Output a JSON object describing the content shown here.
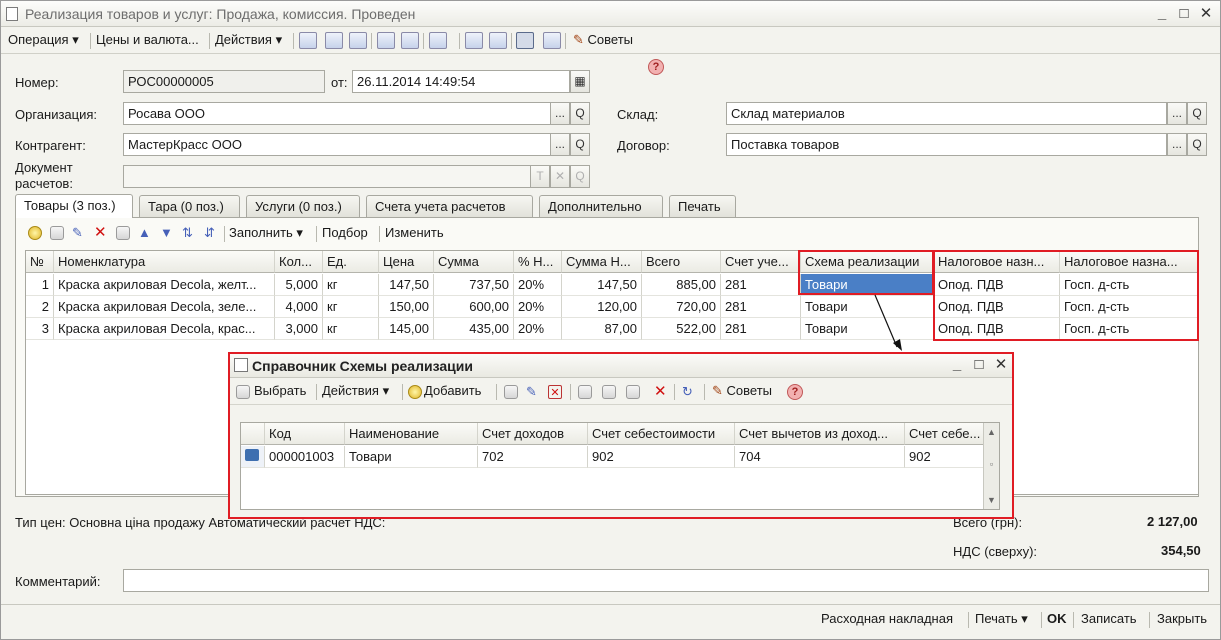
{
  "window": {
    "title": "Реализация товаров и услуг: Продажа, комиссия. Проведен",
    "minimize_glyph": "_",
    "maximize_glyph": "□",
    "close_glyph": "✕"
  },
  "toolbar": {
    "operation": "Операция ▾",
    "prices": "Цены и валюта...",
    "actions": "Действия ▾",
    "tips": "Советы",
    "help": "?"
  },
  "header": {
    "number_label": "Номер:",
    "number_value": "РОС00000005",
    "date_label": "от:",
    "date_value": "26.11.2014 14:49:54",
    "org_label": "Организация:",
    "org_value": "Росава ООО",
    "warehouse_label": "Склад:",
    "warehouse_value": "Склад материалов",
    "counterparty_label": "Контрагент:",
    "counterparty_value": "МастерКрасс ООО",
    "contract_label": "Договор:",
    "contract_value": "Поставка товаров",
    "settle_doc_label_1": "Документ",
    "settle_doc_label_2": "расчетов:",
    "settle_doc_value": "",
    "btn_select": "...",
    "btn_open": "Q",
    "btn_t": "T",
    "btn_x": "✕"
  },
  "tabs": [
    {
      "label": "Товары (3 поз.)"
    },
    {
      "label": "Тара (0 поз.)"
    },
    {
      "label": "Услуги (0 поз.)"
    },
    {
      "label": "Счета учета расчетов"
    },
    {
      "label": "Дополнительно"
    },
    {
      "label": "Печать"
    }
  ],
  "goods_toolbar": {
    "fill": "Заполнить ▾",
    "selection": "Подбор",
    "change": "Изменить"
  },
  "goods_table": {
    "columns": [
      "№",
      "Номенклатура",
      "Кол...",
      "Ед.",
      "Цена",
      "Сумма",
      "% Н...",
      "Сумма Н...",
      "Всего",
      "Счет уче...",
      "Схема реализации",
      "Налоговое назн...",
      "Налоговое назна..."
    ],
    "rows": [
      [
        "1",
        "Краска акриловая Decola, желт...",
        "5,000",
        "кг",
        "147,50",
        "737,50",
        "20%",
        "147,50",
        "885,00",
        "281",
        "Товари",
        "Опод. ПДВ",
        "Госп. д-сть"
      ],
      [
        "2",
        "Краска акриловая Decola, зеле...",
        "4,000",
        "кг",
        "150,00",
        "600,00",
        "20%",
        "120,00",
        "720,00",
        "281",
        "Товари",
        "Опод. ПДВ",
        "Госп. д-сть"
      ],
      [
        "3",
        "Краска акриловая Decola, крас...",
        "3,000",
        "кг",
        "145,00",
        "435,00",
        "20%",
        "87,00",
        "522,00",
        "281",
        "Товари",
        "Опод. ПДВ",
        "Госп. д-сть"
      ]
    ]
  },
  "footer": {
    "price_type": "Тип цен: Основна ціна продажу Автоматический расчет НДС:",
    "total_label": "Всего (грн):",
    "total_value": "2 127,00",
    "vat_label": "НДС (сверху):",
    "vat_value": "354,50",
    "comment_label": "Комментарий:",
    "comment_value": ""
  },
  "bottombar": {
    "invoice": "Расходная накладная",
    "print": "Печать ▾",
    "ok": "OK",
    "write": "Записать",
    "close": "Закрыть"
  },
  "popup": {
    "title": "Справочник Схемы реализации",
    "select": "Выбрать",
    "actions": "Действия ▾",
    "add": "Добавить",
    "tips": "Советы",
    "help": "?",
    "columns": [
      "Код",
      "Наименование",
      "Счет доходов",
      "Счет себестоимости",
      "Счет вычетов из доход...",
      "Счет себе..."
    ],
    "rows": [
      [
        "000001003",
        "Товари",
        "702",
        "902",
        "704",
        "902"
      ]
    ]
  }
}
